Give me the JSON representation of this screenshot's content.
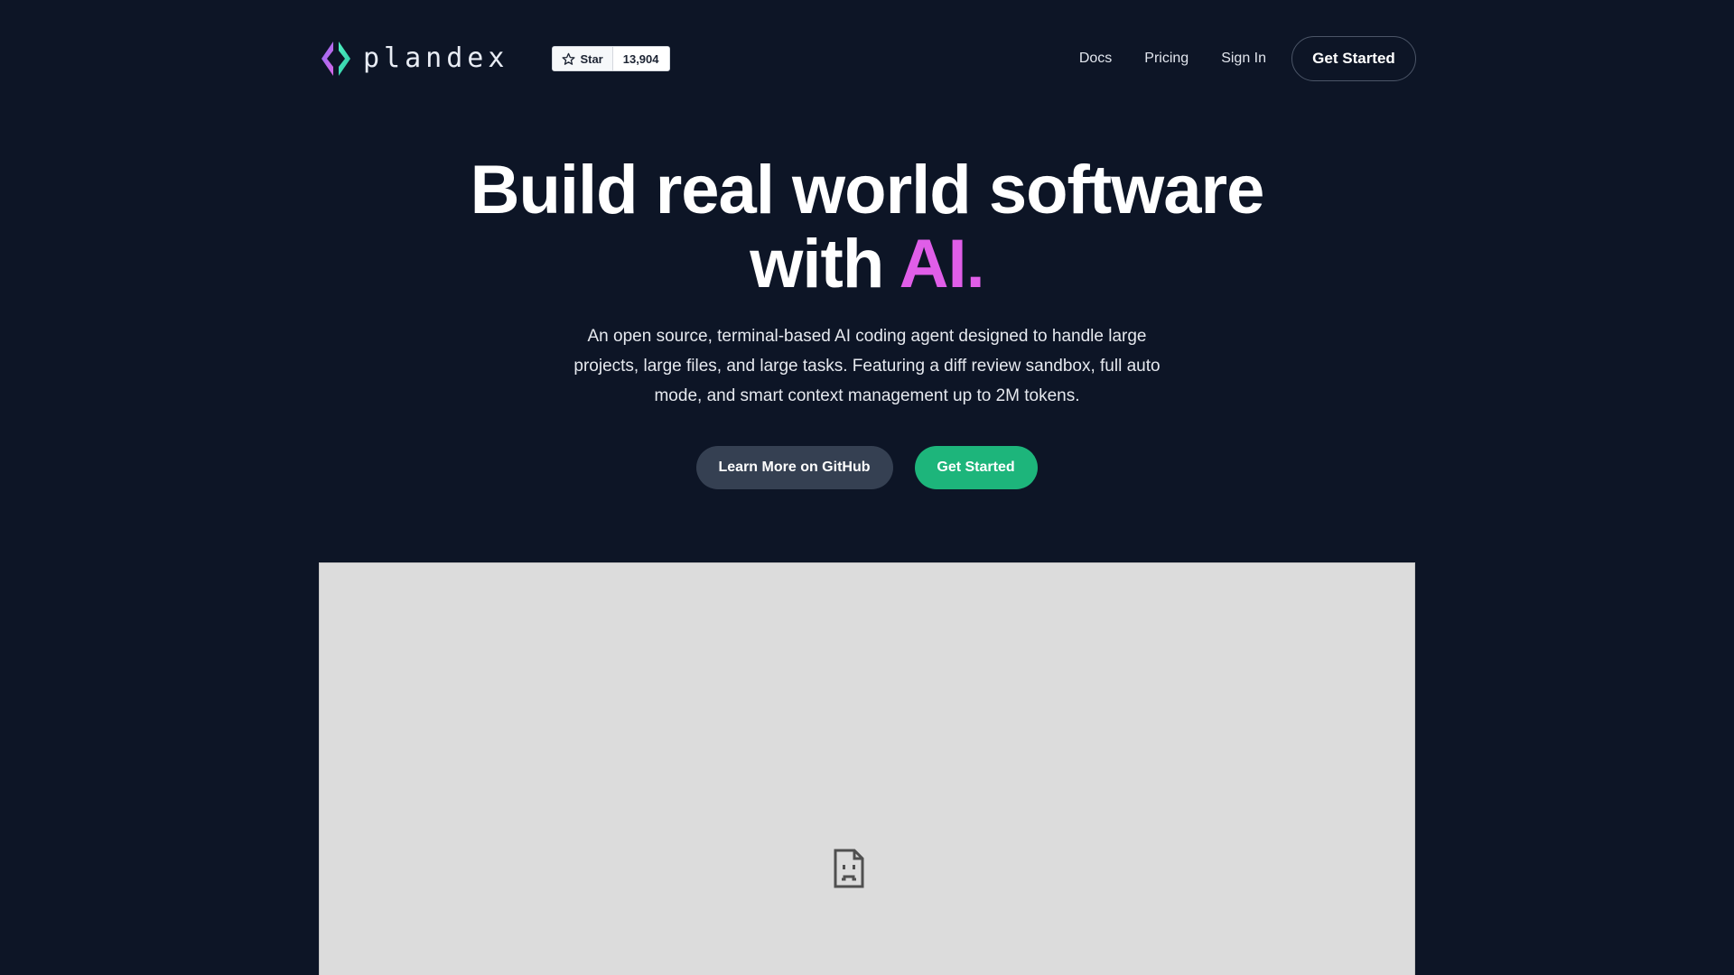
{
  "header": {
    "brand": "plandex",
    "github_star": {
      "label": "Star",
      "count": "13,904"
    },
    "nav": [
      {
        "label": "Docs"
      },
      {
        "label": "Pricing"
      },
      {
        "label": "Sign In"
      }
    ],
    "cta_label": "Get Started"
  },
  "hero": {
    "title_line1": "Build real world software",
    "title_line2_prefix": "with ",
    "title_line2_accent": "AI.",
    "subtitle": "An open source, terminal-based AI coding agent designed to handle large projects, large files, and large tasks. Featuring a diff review sandbox, full auto mode, and smart context management up to 2M tokens.",
    "buttons": {
      "github_label": "Learn More on GitHub",
      "start_label": "Get Started"
    }
  },
  "media": {
    "icon": "broken-image-icon"
  },
  "colors": {
    "background": "#0d1526",
    "accent_pink": "#e05ee8",
    "accent_green": "#1db57b",
    "secondary_button": "#354052",
    "logo_purple": "#b36bf2",
    "logo_green": "#3ee6b0"
  }
}
